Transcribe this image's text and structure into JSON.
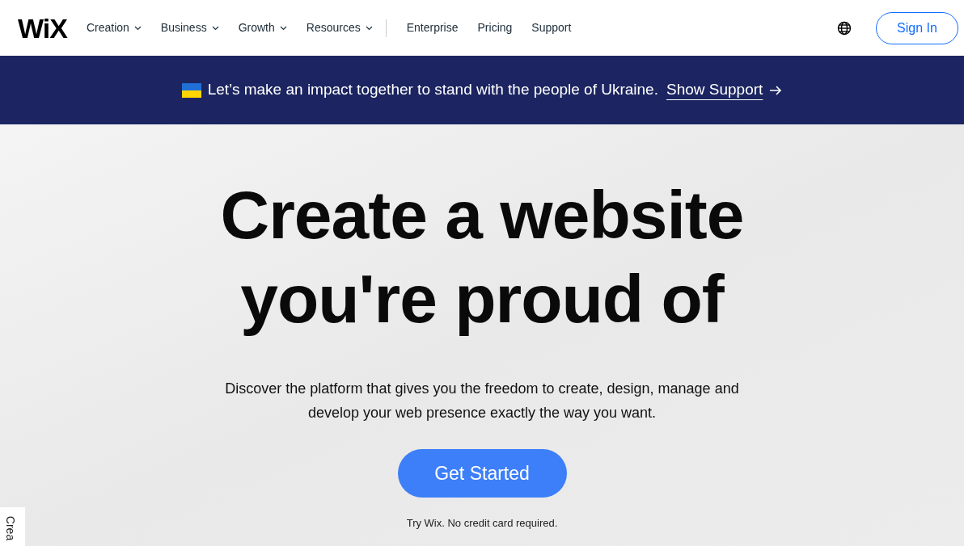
{
  "header": {
    "logo": "WiX",
    "nav": [
      {
        "label": "Creation",
        "dropdown": true
      },
      {
        "label": "Business",
        "dropdown": true
      },
      {
        "label": "Growth",
        "dropdown": true
      },
      {
        "label": "Resources",
        "dropdown": true
      },
      {
        "label": "Enterprise",
        "dropdown": false
      },
      {
        "label": "Pricing",
        "dropdown": false
      },
      {
        "label": "Support",
        "dropdown": false
      }
    ],
    "sign_in": "Sign In"
  },
  "banner": {
    "text": "Let’s make an impact together to stand with the people of Ukraine.",
    "link": "Show Support"
  },
  "hero": {
    "headline_lines": [
      "Create a website",
      "you're proud of"
    ],
    "description": "Discover the platform that gives you the freedom to create, design, manage and develop your web presence exactly the way you want.",
    "cta": "Get Started",
    "note": "Try Wix. No credit card required."
  },
  "side_tab": "Crea"
}
